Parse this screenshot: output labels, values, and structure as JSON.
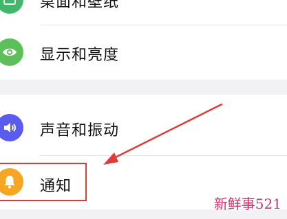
{
  "settings": {
    "items": [
      {
        "label": "桌面和壁纸",
        "icon": "wallpaper-icon",
        "icon_color": "#3fb86a"
      },
      {
        "label": "显示和亮度",
        "icon": "eye-icon",
        "icon_color": "#5cbf5a"
      },
      {
        "label": "声音和振动",
        "icon": "speaker-icon",
        "icon_color": "#5b5bf0"
      },
      {
        "label": "通知",
        "icon": "bell-icon",
        "icon_color": "#f5a623"
      }
    ]
  },
  "annotation": {
    "arrow_color": "#e03a3a",
    "box_color": "#e03a3a"
  },
  "watermark": {
    "text": "新鲜事521",
    "color": "#c9356b"
  }
}
